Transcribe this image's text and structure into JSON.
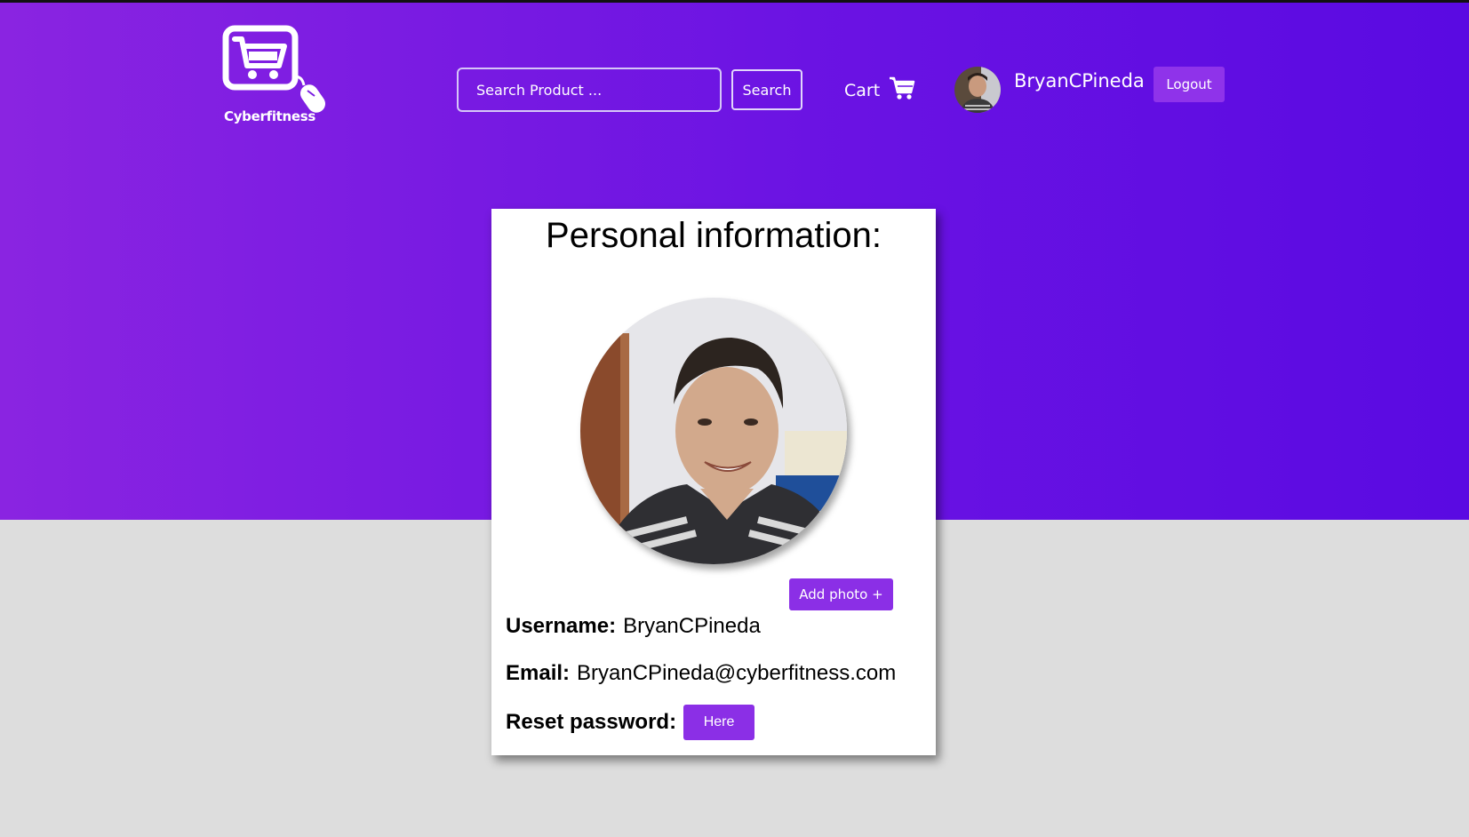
{
  "brand": {
    "name": "Cyberfitness",
    "logo_icon": "cart-mouse-logo"
  },
  "search": {
    "placeholder": "Search Product ...",
    "value": "",
    "button_label": "Search"
  },
  "cart": {
    "label": "Cart",
    "icon": "shopping-cart-icon"
  },
  "user": {
    "username": "BryanCPineda",
    "avatar_icon": "user-avatar"
  },
  "logout_label": "Logout",
  "profile": {
    "title": "Personal information:",
    "add_photo_label": "Add photo +",
    "username_label": "Username:",
    "username_value": "BryanCPineda",
    "email_label": "Email:",
    "email_value": "BryanCPineda@cyberfitness.com",
    "reset_label": "Reset password:",
    "reset_button_label": "Here"
  },
  "colors": {
    "accent": "#8b2fe6",
    "gradient_start": "#8a24e1",
    "gradient_end": "#5a0ae2",
    "background": "#dddddd"
  }
}
